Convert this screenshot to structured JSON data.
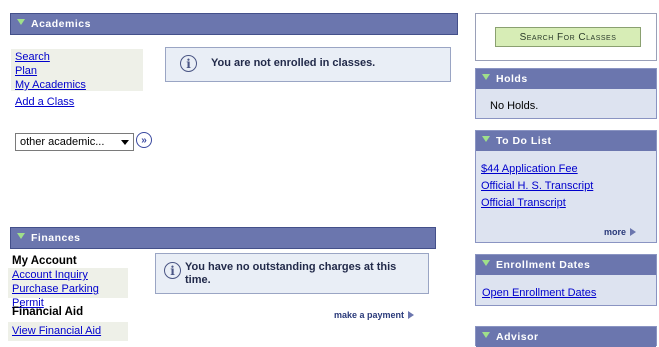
{
  "academics": {
    "title": "Academics",
    "links": [
      "Search",
      "Plan",
      "My Academics"
    ],
    "add_class": "Add a Class",
    "select_value": "other academic...",
    "message": "You are not enrolled in classes."
  },
  "finances": {
    "title": "Finances",
    "my_account_heading": "My Account",
    "account_links": [
      "Account Inquiry",
      "Purchase Parking Permit"
    ],
    "financial_aid_heading": "Financial Aid",
    "aid_links": [
      "View Financial Aid"
    ],
    "message": "You have no outstanding charges at this time.",
    "make_payment": "make a payment"
  },
  "search_button": "Search For Classes",
  "holds": {
    "title": "Holds",
    "text": "No Holds."
  },
  "todo": {
    "title": "To Do List",
    "items": [
      "$44 Application Fee",
      "Official H. S. Transcript",
      "Official Transcript"
    ],
    "more": "more"
  },
  "enrollment": {
    "title": "Enrollment Dates",
    "link": "Open Enrollment Dates"
  },
  "advisor": {
    "title": "Advisor"
  },
  "colors": {
    "header_bg": "#6b76ae",
    "panel_bg": "#dde3f0",
    "button_bg": "#d7edb6",
    "link": "#0000cc"
  }
}
